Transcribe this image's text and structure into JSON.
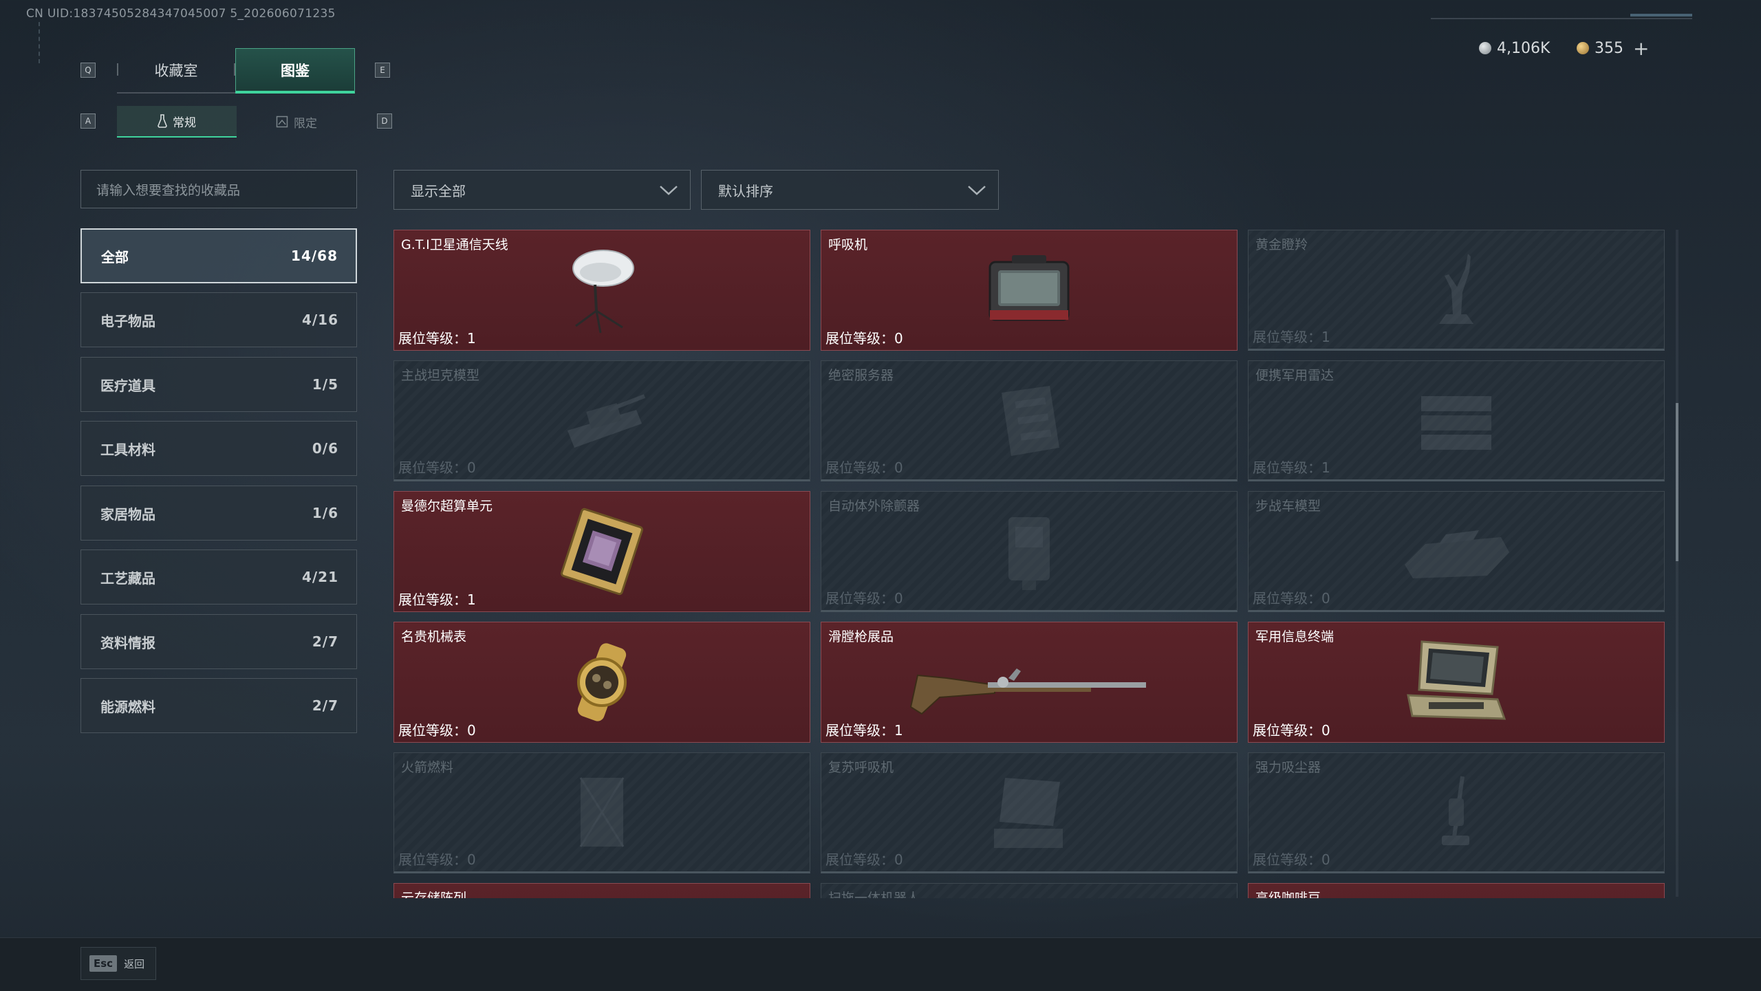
{
  "header": {
    "uid": "CN UID:18374505284347045007 5_202606071235",
    "tabs": [
      {
        "label": "收藏室",
        "hotkey": "Q"
      },
      {
        "label": "图鉴",
        "hotkey": "E"
      }
    ],
    "subtabs": [
      {
        "label": "常规",
        "hotkey": "A"
      },
      {
        "label": "限定",
        "hotkey": "D"
      }
    ]
  },
  "currency": {
    "silver": "4,106K",
    "gold": "355",
    "add": "+"
  },
  "sidebar": {
    "search_placeholder": "请输入想要查找的收藏品",
    "categories": [
      {
        "label": "全部",
        "count": "14/68"
      },
      {
        "label": "电子物品",
        "count": "4/16"
      },
      {
        "label": "医疗道具",
        "count": "1/5"
      },
      {
        "label": "工具材料",
        "count": "0/6"
      },
      {
        "label": "家居物品",
        "count": "1/6"
      },
      {
        "label": "工艺藏品",
        "count": "4/21"
      },
      {
        "label": "资料情报",
        "count": "2/7"
      },
      {
        "label": "能源燃料",
        "count": "2/7"
      }
    ]
  },
  "filters": {
    "show": "显示全部",
    "sort": "默认排序"
  },
  "items": [
    {
      "name": "G.T.I卫星通信天线",
      "level": "展位等级：1",
      "icon": "satellite-dish-icon"
    },
    {
      "name": "呼吸机",
      "level": "展位等级：0",
      "icon": "ventilator-icon"
    },
    {
      "name": "黄金瞪羚",
      "level": "展位等级：1",
      "icon": "gazelle-statue-icon"
    },
    {
      "name": "主战坦克模型",
      "level": "展位等级：0",
      "icon": "tank-model-icon"
    },
    {
      "name": "绝密服务器",
      "level": "展位等级：0",
      "icon": "server-icon"
    },
    {
      "name": "便携军用雷达",
      "level": "展位等级：1",
      "icon": "radar-icon"
    },
    {
      "name": "曼德尔超算单元",
      "level": "展位等级：1",
      "icon": "supercomputer-unit-icon"
    },
    {
      "name": "自动体外除颤器",
      "level": "展位等级：0",
      "icon": "defibrillator-icon"
    },
    {
      "name": "步战车模型",
      "level": "展位等级：0",
      "icon": "ifv-model-icon"
    },
    {
      "name": "名贵机械表",
      "level": "展位等级：0",
      "icon": "watch-icon"
    },
    {
      "name": "滑膛枪展品",
      "level": "展位等级：1",
      "icon": "musket-icon"
    },
    {
      "name": "军用信息终端",
      "level": "展位等级：0",
      "icon": "military-terminal-icon"
    },
    {
      "name": "火箭燃料",
      "level": "展位等级：0",
      "icon": "rocket-fuel-icon"
    },
    {
      "name": "复苏呼吸机",
      "level": "展位等级：0",
      "icon": "resuscitator-icon"
    },
    {
      "name": "强力吸尘器",
      "level": "展位等级：0",
      "icon": "vacuum-icon"
    },
    {
      "name": "云存储阵列",
      "level": "",
      "icon": "storage-array-icon"
    },
    {
      "name": "扫拖一体机器人",
      "level": "",
      "icon": "robot-vacuum-icon"
    },
    {
      "name": "高级咖啡豆",
      "level": "",
      "icon": "coffee-beans-icon"
    }
  ],
  "footer": {
    "esc_key": "Esc",
    "back_label": "返回"
  },
  "colors": {
    "accent": "#3fd39c",
    "owned_card": "#541f25",
    "locked_card": "#242e37"
  }
}
